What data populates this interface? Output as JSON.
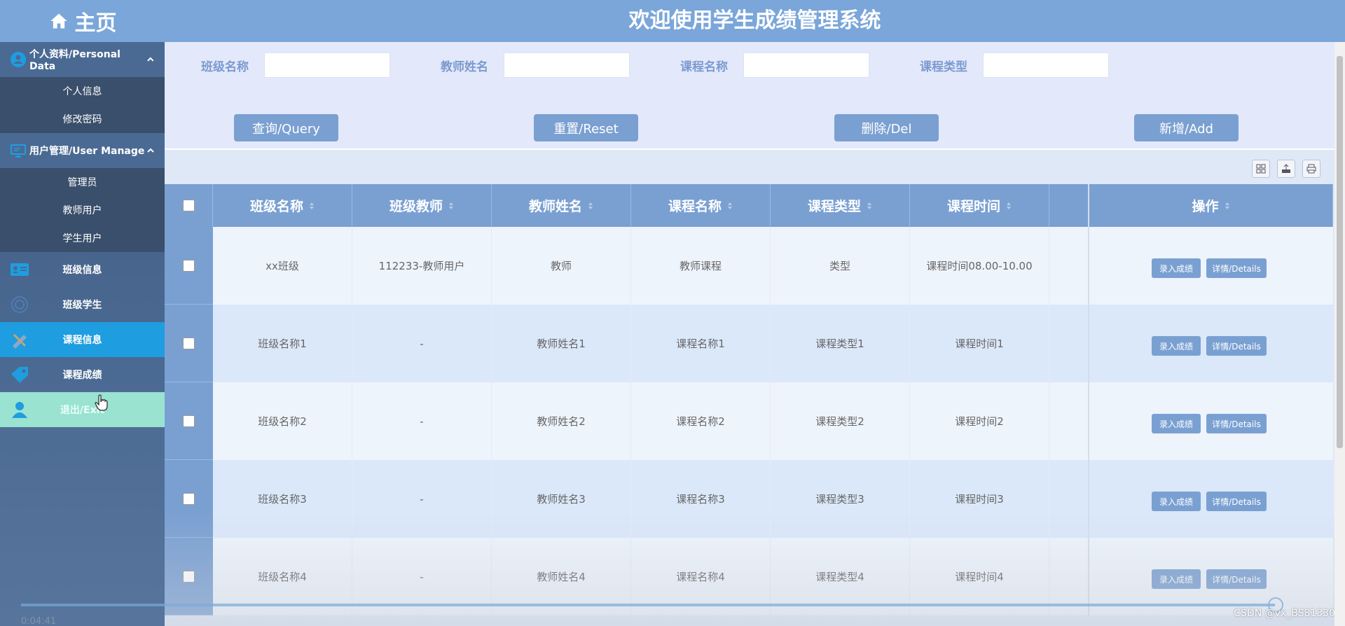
{
  "sidebar": {
    "home": "主页",
    "groups": [
      {
        "label": "个人资料/Personal Data",
        "items": [
          "个人信息",
          "修改密码"
        ]
      },
      {
        "label": "用户管理/User Manage",
        "items": [
          "管理员",
          "教师用户",
          "学生用户"
        ]
      }
    ],
    "nav": [
      "班级信息",
      "班级学生",
      "课程信息",
      "课程成绩",
      "退出/Exit"
    ]
  },
  "header": {
    "title": "欢迎使用学生成绩管理系统"
  },
  "search": {
    "fields": [
      "班级名称",
      "教师姓名",
      "课程名称",
      "课程类型"
    ],
    "buttons": [
      "查询/Query",
      "重置/Reset",
      "删除/Del",
      "新增/Add"
    ]
  },
  "table": {
    "columns": [
      "班级名称",
      "班级教师",
      "教师姓名",
      "课程名称",
      "课程类型",
      "课程时间",
      "操作"
    ],
    "rows": [
      [
        "xx班级",
        "112233-教师用户",
        "教师",
        "教师课程",
        "类型",
        "课程时间08.00-10.00"
      ],
      [
        "班级名称1",
        "-",
        "教师姓名1",
        "课程名称1",
        "课程类型1",
        "课程时间1"
      ],
      [
        "班级名称2",
        "-",
        "教师姓名2",
        "课程名称2",
        "课程类型2",
        "课程时间2"
      ],
      [
        "班级名称3",
        "-",
        "教师姓名3",
        "课程名称3",
        "课程类型3",
        "课程时间3"
      ],
      [
        "班级名称4",
        "-",
        "教师姓名4",
        "课程名称4",
        "课程类型4",
        "课程时间4"
      ]
    ],
    "row_actions": [
      "录入成绩",
      "详情/Details"
    ]
  },
  "player": {
    "time": "0:04:41"
  },
  "watermark": "CSDN @vx_BS81330",
  "colors": {
    "primary": "#7aa0d2",
    "active_nav": "#1e9de0",
    "exit_nav": "#99e3d0",
    "sidebar": "#4a6a93"
  }
}
